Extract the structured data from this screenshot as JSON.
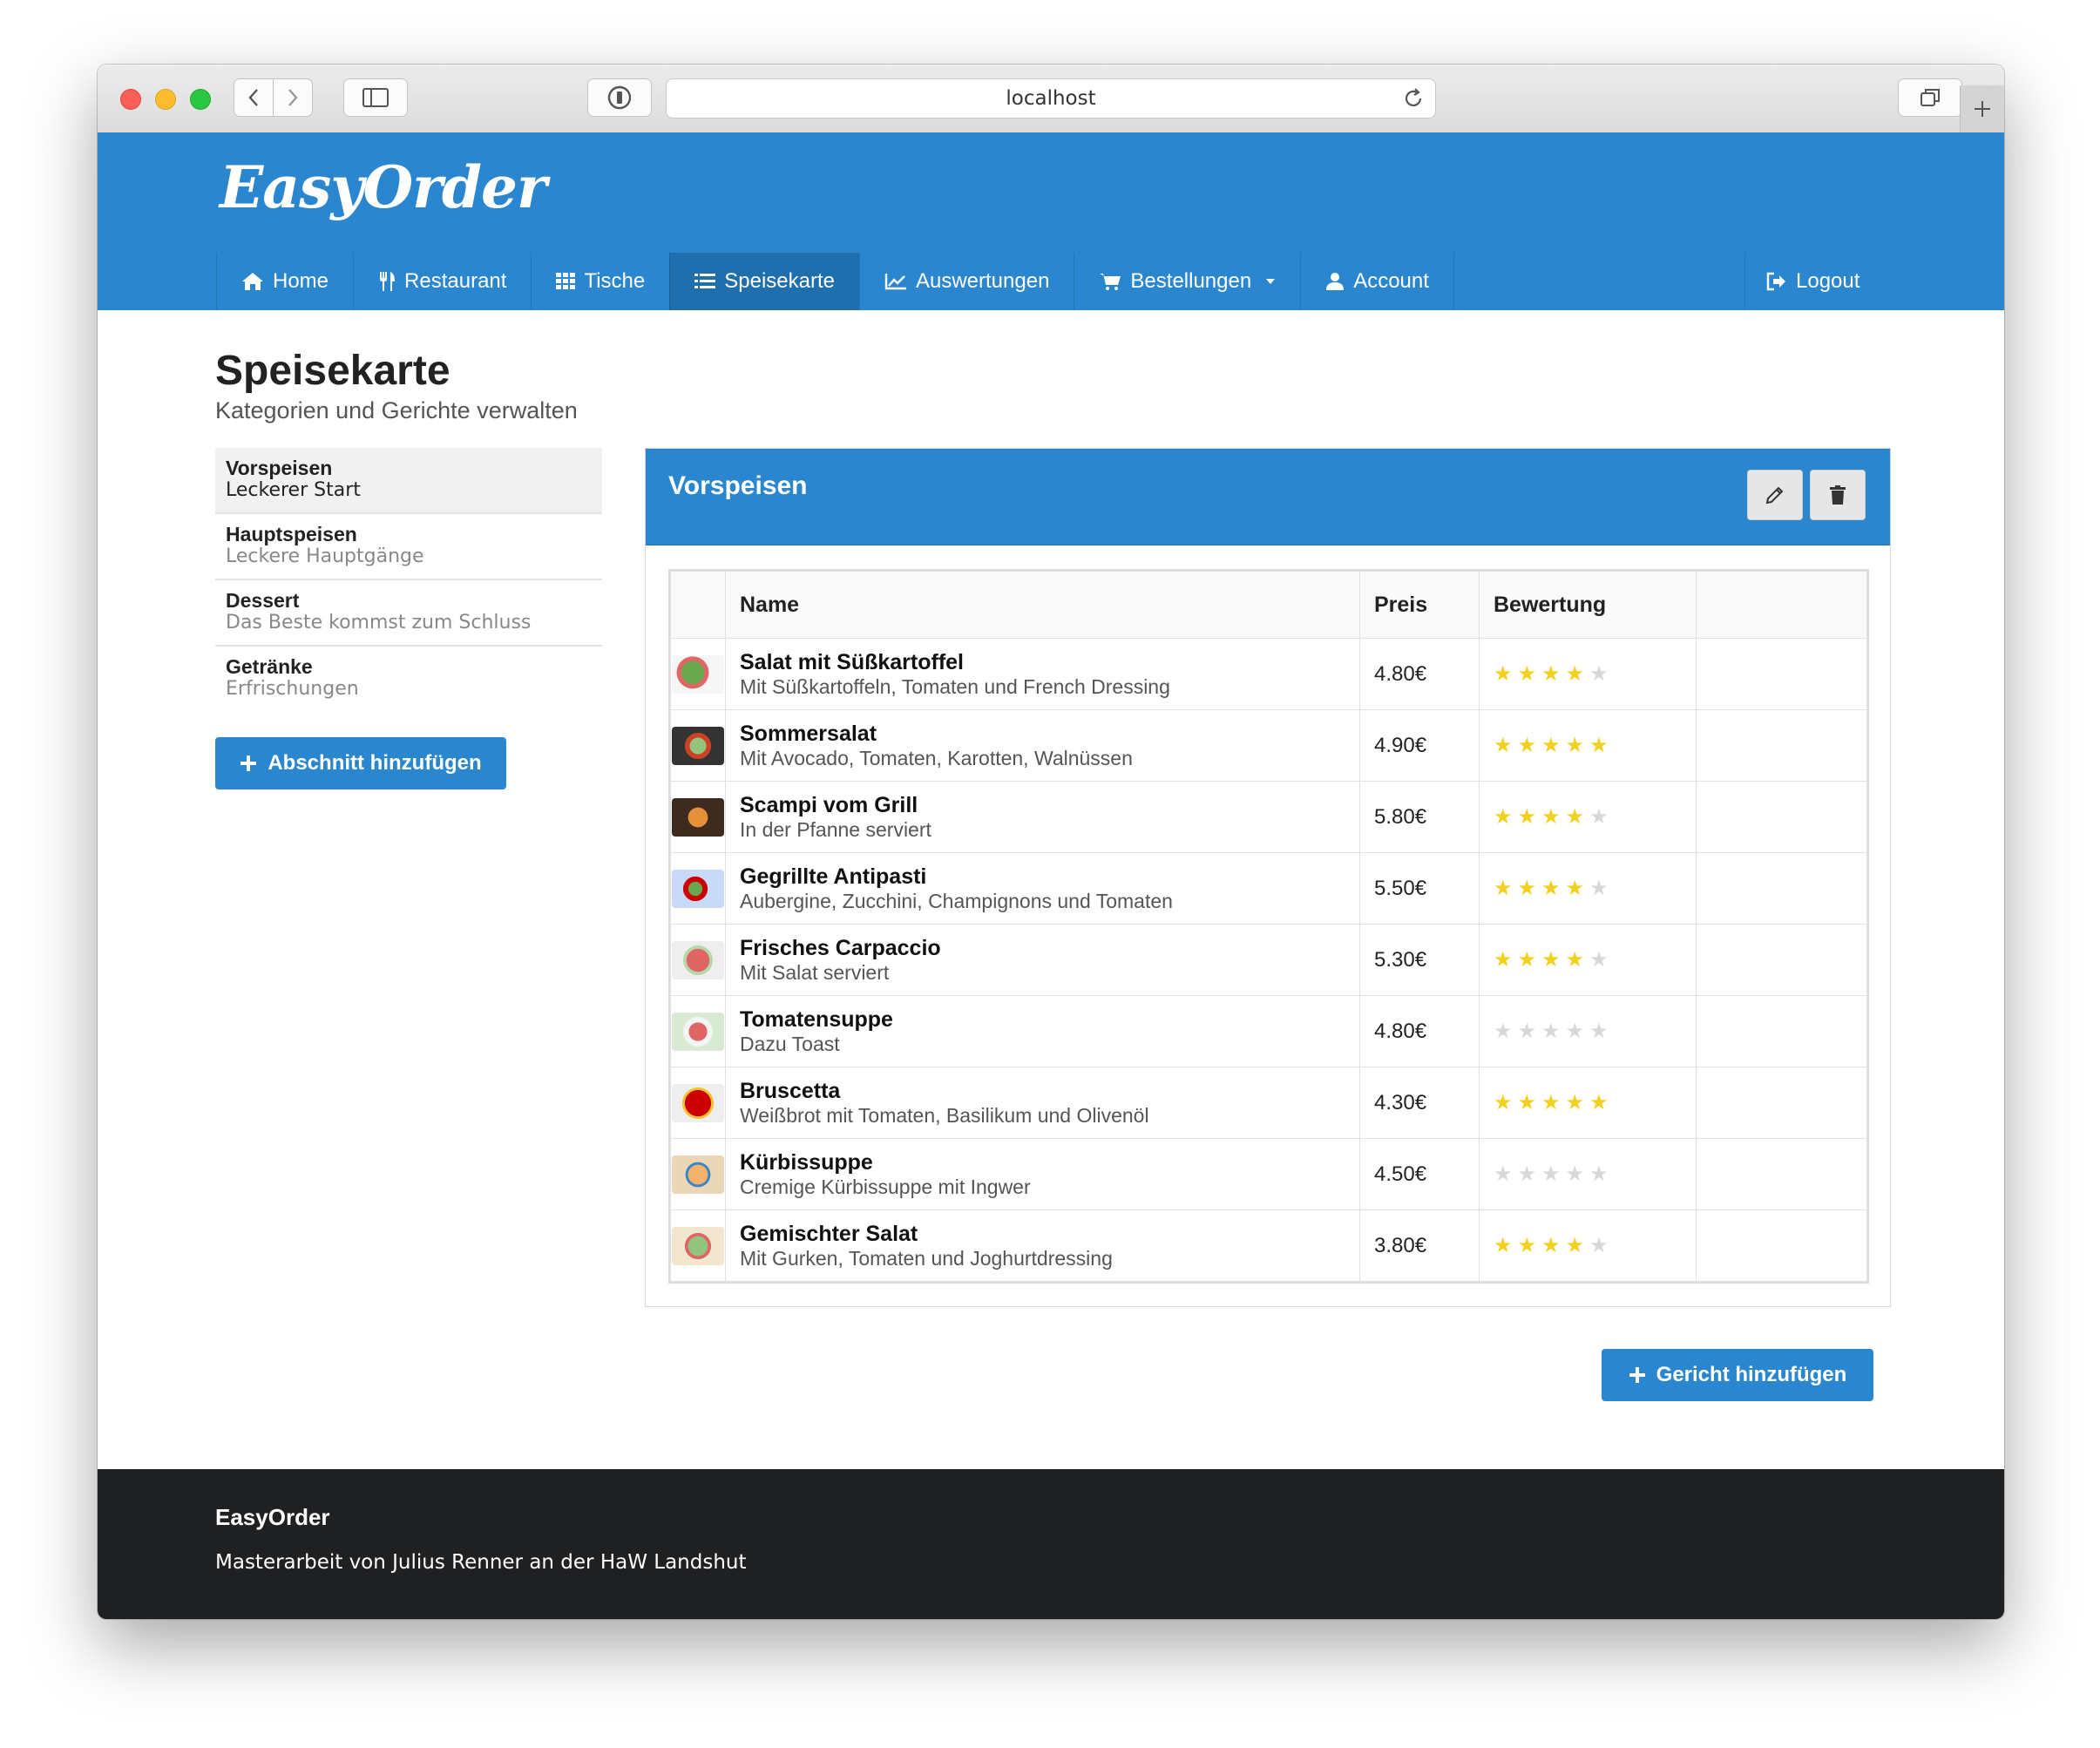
{
  "browser": {
    "url": "localhost"
  },
  "app": {
    "logo": "EasyOrder"
  },
  "nav": {
    "items": [
      {
        "label": "Home",
        "icon": "home-icon"
      },
      {
        "label": "Restaurant",
        "icon": "cutlery-icon"
      },
      {
        "label": "Tische",
        "icon": "grid-icon"
      },
      {
        "label": "Speisekarte",
        "icon": "list-icon",
        "active": true
      },
      {
        "label": "Auswertungen",
        "icon": "chart-icon"
      },
      {
        "label": "Bestellungen",
        "icon": "cart-icon"
      },
      {
        "label": "Account",
        "icon": "user-icon"
      }
    ],
    "logout": "Logout"
  },
  "page": {
    "title": "Speisekarte",
    "subtitle": "Kategorien und Gerichte verwalten"
  },
  "categories": [
    {
      "name": "Vorspeisen",
      "desc": "Leckerer Start"
    },
    {
      "name": "Hauptspeisen",
      "desc": "Leckere Hauptgänge"
    },
    {
      "name": "Dessert",
      "desc": "Das Beste kommst zum Schluss"
    },
    {
      "name": "Getränke",
      "desc": "Erfrischungen"
    }
  ],
  "add_section_label": "Abschnitt hinzufügen",
  "panel": {
    "title": "Vorspeisen"
  },
  "table": {
    "headers": {
      "name": "Name",
      "price": "Preis",
      "rating": "Bewertung"
    },
    "rows": [
      {
        "name": "Salat mit Süßkartoffel",
        "desc": "Mit Süßkartoffeln, Tomaten und French Dressing",
        "price": "4.80€",
        "rating": 4
      },
      {
        "name": "Sommersalat",
        "desc": "Mit Avocado, Tomaten, Karotten, Walnüssen",
        "price": "4.90€",
        "rating": 5
      },
      {
        "name": "Scampi vom Grill",
        "desc": "In der Pfanne serviert",
        "price": "5.80€",
        "rating": 4
      },
      {
        "name": "Gegrillte Antipasti",
        "desc": "Aubergine, Zucchini, Champignons und Tomaten",
        "price": "5.50€",
        "rating": 4
      },
      {
        "name": "Frisches Carpaccio",
        "desc": "Mit Salat serviert",
        "price": "5.30€",
        "rating": 4
      },
      {
        "name": "Tomatensuppe",
        "desc": "Dazu Toast",
        "price": "4.80€",
        "rating": 0
      },
      {
        "name": "Bruscetta",
        "desc": "Weißbrot mit Tomaten, Basilikum und Olivenöl",
        "price": "4.30€",
        "rating": 5
      },
      {
        "name": "Kürbissuppe",
        "desc": "Cremige Kürbissuppe mit Ingwer",
        "price": "4.50€",
        "rating": 0
      },
      {
        "name": "Gemischter Salat",
        "desc": "Mit Gurken, Tomaten und Joghurtdressing",
        "price": "3.80€",
        "rating": 4
      }
    ]
  },
  "add_dish_label": "Gericht hinzufügen",
  "footer": {
    "title": "EasyOrder",
    "text": "Masterarbeit von Julius Renner an der HaW Landshut"
  },
  "colors": {
    "primary": "#2a87cf",
    "primary_dark": "#1f6fae",
    "star": "#f3cf1f",
    "footer": "#1f2022"
  }
}
